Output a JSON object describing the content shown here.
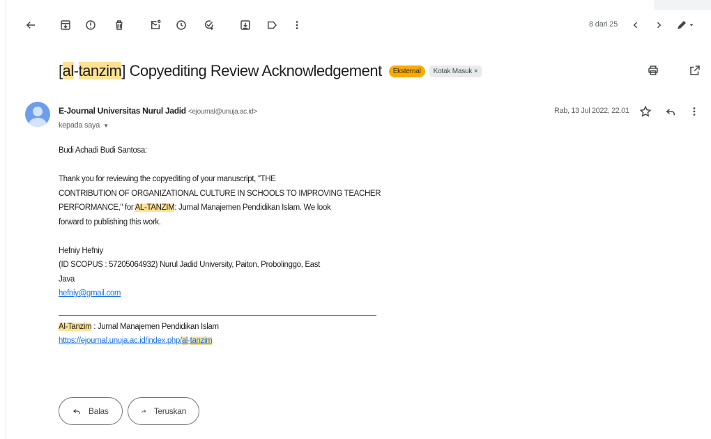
{
  "toolbar": {
    "pager_text": "8 dari 25",
    "icons": [
      "back-arrow-icon",
      "archive-icon",
      "report-spam-icon",
      "delete-icon",
      "mark-unread-icon",
      "snooze-icon",
      "add-task-icon",
      "move-to-icon",
      "label-icon",
      "more-vert-icon",
      "prev-chevron-icon",
      "next-chevron-icon",
      "pen-icon",
      "dropdown-caret-icon"
    ]
  },
  "subject": {
    "open_bracket": "[",
    "hl1": "al",
    "dash": "-",
    "hl2": "tanzim",
    "rest": "] Copyediting Review Acknowledgement",
    "badge_external": "Eksternal",
    "badge_inbox": "Kotak Masuk ×"
  },
  "sender": {
    "name": "E-Journal Universitas Nurul Jadid",
    "email": "<ejournal@unuja.ac.id>",
    "to": "kepada saya",
    "date": "Rab, 13 Jul 2022, 22.01"
  },
  "body": {
    "greeting": "Budi Achadi Budi Santosa:",
    "p1_line1": "Thank you for reviewing the copyediting of your manuscript, \"THE",
    "p1_line2": "CONTRIBUTION OF ORGANIZATIONAL CULTURE IN SCHOOLS TO IMPROVING TEACHER",
    "p1_line3_pre": "PERFORMANCE,\" for ",
    "p1_line3_hl": "AL-TANZIM",
    "p1_line3_post": ": Jurnal Manajemen Pendidikan Islam. We look",
    "p1_line4": "forward to publishing this work.",
    "sig_name": "Hefniy Hefniy",
    "sig_line2": "(ID SCOPUS : 57205064932) Nurul Jadid University, Paiton, Probolinggo, East",
    "sig_line3": "Java",
    "sig_email": "hefniy@gmail.com",
    "footer_hl": "Al-Tanzim",
    "footer_rest": " : Jurnal Manajemen Pendidikan Islam",
    "footer_url_pre": "https://ejournal.unuja.ac.id/index.php/",
    "footer_url_hl1": "al",
    "footer_url_dash": "-",
    "footer_url_hl2": "tanzim"
  },
  "actions": {
    "reply_label": "Balas",
    "forward_label": "Teruskan"
  },
  "colors": {
    "highlight": "#fde293",
    "badge_external": "#f9ab00",
    "link": "#1a73e8",
    "avatar": "#6d9eeb"
  }
}
